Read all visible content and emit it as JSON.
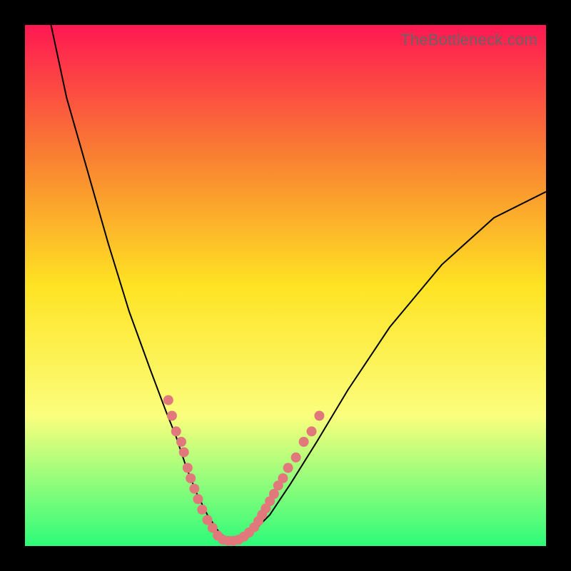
{
  "watermark": "TheBottleneck.com",
  "colors": {
    "gradient_top": "#ff1852",
    "gradient_upper_mid": "#f97f32",
    "gradient_mid": "#ffe323",
    "gradient_lower_mid": "#fbfe7d",
    "gradient_bottom": "#2dfb7a",
    "curve": "#000000",
    "dots": "#e1787b",
    "frame": "#000000"
  },
  "chart_data": {
    "type": "line",
    "title": "",
    "xlabel": "",
    "ylabel": "",
    "xlim": [
      0,
      100
    ],
    "ylim": [
      0,
      100
    ],
    "grid": false,
    "legend": false,
    "series": [
      {
        "name": "curve",
        "x": [
          5,
          8,
          12,
          16,
          20,
          24,
          27,
          29,
          31,
          33,
          35,
          37,
          39,
          41,
          43,
          47,
          51,
          56,
          62,
          70,
          80,
          90,
          100
        ],
        "y": [
          100,
          86,
          72,
          58,
          45,
          34,
          26,
          21,
          15,
          10,
          6,
          3,
          1,
          1,
          2,
          6,
          12,
          20,
          30,
          42,
          54,
          63,
          68
        ]
      }
    ],
    "scatter": [
      {
        "name": "dots",
        "points": [
          {
            "x": 27.5,
            "y": 28
          },
          {
            "x": 28.2,
            "y": 25
          },
          {
            "x": 29.0,
            "y": 22
          },
          {
            "x": 30.0,
            "y": 20
          },
          {
            "x": 30.5,
            "y": 18
          },
          {
            "x": 31.2,
            "y": 15
          },
          {
            "x": 31.8,
            "y": 13
          },
          {
            "x": 32.5,
            "y": 11
          },
          {
            "x": 33.2,
            "y": 9
          },
          {
            "x": 34.0,
            "y": 7
          },
          {
            "x": 35.0,
            "y": 5
          },
          {
            "x": 36.0,
            "y": 3.5
          },
          {
            "x": 37.0,
            "y": 2
          },
          {
            "x": 38.0,
            "y": 1.2
          },
          {
            "x": 39.0,
            "y": 1
          },
          {
            "x": 40.0,
            "y": 1
          },
          {
            "x": 41.0,
            "y": 1.2
          },
          {
            "x": 42.0,
            "y": 1.8
          },
          {
            "x": 43.0,
            "y": 2.6
          },
          {
            "x": 44.0,
            "y": 3.6
          },
          {
            "x": 44.8,
            "y": 4.8
          },
          {
            "x": 45.5,
            "y": 6
          },
          {
            "x": 46.2,
            "y": 7.2
          },
          {
            "x": 47.0,
            "y": 8.6
          },
          {
            "x": 47.8,
            "y": 10
          },
          {
            "x": 48.6,
            "y": 11.6
          },
          {
            "x": 49.5,
            "y": 13
          },
          {
            "x": 50.5,
            "y": 15
          },
          {
            "x": 52.0,
            "y": 17
          },
          {
            "x": 53.5,
            "y": 20
          },
          {
            "x": 55.0,
            "y": 22
          },
          {
            "x": 56.5,
            "y": 25
          }
        ]
      }
    ]
  }
}
